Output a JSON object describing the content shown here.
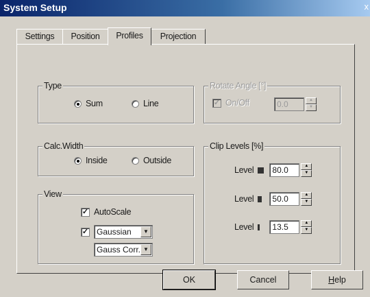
{
  "window": {
    "title": "System Setup",
    "close": "x"
  },
  "tabs": [
    {
      "label": "Settings"
    },
    {
      "label": "Position"
    },
    {
      "label": "Profiles"
    },
    {
      "label": "Projection"
    }
  ],
  "active_tab": "Profiles",
  "type": {
    "legend": "Type",
    "options": [
      "Sum",
      "Line"
    ],
    "selected": "Sum"
  },
  "calc_width": {
    "legend": "Calc.Width",
    "options": [
      "Inside",
      "Outside"
    ],
    "selected": "Inside"
  },
  "view": {
    "legend": "View",
    "autoscale_label": "AutoScale",
    "autoscale_checked": true,
    "profile_checked": true,
    "profile_select": "Gaussian",
    "corr_select": "Gauss Corr."
  },
  "rotate": {
    "legend": "Rotate Angle [°]",
    "onoff_label": "On/Off",
    "onoff_checked": true,
    "angle_value": "0.0",
    "enabled": false
  },
  "clip": {
    "legend": "Clip Levels [%]",
    "levels": [
      {
        "label": "Level",
        "value": "80.0"
      },
      {
        "label": "Level",
        "value": "50.0"
      },
      {
        "label": "Level",
        "value": "13.5"
      }
    ]
  },
  "buttons": {
    "ok": "OK",
    "cancel": "Cancel",
    "help_u": "H",
    "help_rest": "elp"
  },
  "icons": {
    "check": "✓",
    "up": "▲",
    "down": "▼"
  }
}
